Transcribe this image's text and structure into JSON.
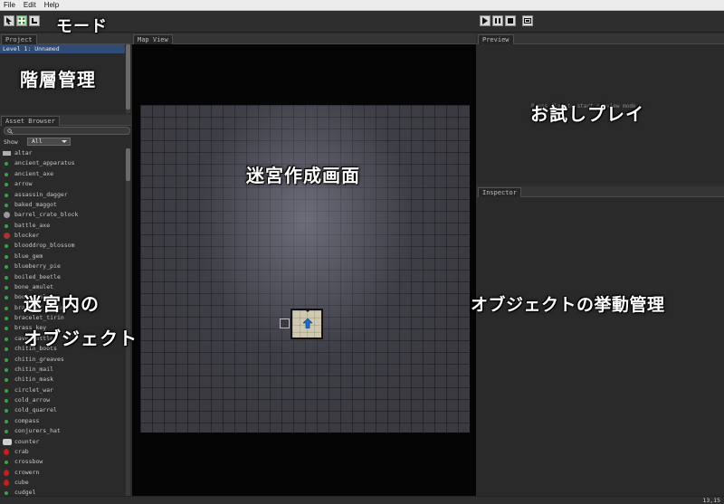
{
  "menu": {
    "items": [
      "File",
      "Edit",
      "Help"
    ]
  },
  "panels": {
    "project": {
      "tab": "Project",
      "selected_row": "Level 1: Unnamed"
    },
    "asset_browser": {
      "tab": "Asset Browser",
      "show_label": "Show",
      "show_value": "All",
      "items": [
        {
          "label": "altar",
          "icon": "flag-icon"
        },
        {
          "label": "ancient_apparatus",
          "icon": "item-dot-icon"
        },
        {
          "label": "ancient_axe",
          "icon": "item-dot-icon"
        },
        {
          "label": "arrow",
          "icon": "item-dot-icon"
        },
        {
          "label": "assassin_dagger",
          "icon": "item-dot-icon"
        },
        {
          "label": "baked_maggot",
          "icon": "item-dot-icon"
        },
        {
          "label": "barrel_crate_block",
          "icon": "barrel-icon"
        },
        {
          "label": "battle_axe",
          "icon": "item-dot-icon"
        },
        {
          "label": "blocker",
          "icon": "blocker-icon"
        },
        {
          "label": "blooddrop_blossom",
          "icon": "item-dot-icon"
        },
        {
          "label": "blue_gem",
          "icon": "item-dot-icon"
        },
        {
          "label": "blueberry_pie",
          "icon": "item-dot-icon"
        },
        {
          "label": "boiled_beetle",
          "icon": "item-dot-icon"
        },
        {
          "label": "bone_amulet",
          "icon": "item-dot-icon"
        },
        {
          "label": "boots_valor",
          "icon": "item-dot-icon"
        },
        {
          "label": "bracelet_tirin",
          "icon": "item-dot-icon"
        },
        {
          "label": "bracelet_tirin",
          "icon": "item-dot-icon"
        },
        {
          "label": "brass_key",
          "icon": "item-dot-icon"
        },
        {
          "label": "cave_nettle",
          "icon": "item-dot-icon"
        },
        {
          "label": "chitin_boots",
          "icon": "item-dot-icon"
        },
        {
          "label": "chitin_greaves",
          "icon": "item-dot-icon"
        },
        {
          "label": "chitin_mail",
          "icon": "item-dot-icon"
        },
        {
          "label": "chitin_mask",
          "icon": "item-dot-icon"
        },
        {
          "label": "circlet_war",
          "icon": "item-dot-icon"
        },
        {
          "label": "cold_arrow",
          "icon": "item-dot-icon"
        },
        {
          "label": "cold_quarrel",
          "icon": "item-dot-icon"
        },
        {
          "label": "compass",
          "icon": "item-dot-icon"
        },
        {
          "label": "conjurers_hat",
          "icon": "item-dot-icon"
        },
        {
          "label": "counter",
          "icon": "counter-icon"
        },
        {
          "label": "crab",
          "icon": "blood-drop-icon"
        },
        {
          "label": "crossbow",
          "icon": "item-dot-icon"
        },
        {
          "label": "crowern",
          "icon": "blood-drop-icon"
        },
        {
          "label": "cube",
          "icon": "blood-drop-icon"
        },
        {
          "label": "cudgel",
          "icon": "item-dot-icon"
        }
      ]
    },
    "map_view": {
      "tab": "Map View"
    },
    "preview": {
      "tab": "Preview",
      "hint": "Press Play to start preview mode"
    },
    "inspector": {
      "tab": "Inspector"
    }
  },
  "status": {
    "coords": "13,15"
  },
  "annotations": {
    "mode": "モード",
    "hierarchy": "階層管理",
    "trial_play": "お試しプレイ",
    "maze_editor": "迷宮作成画面",
    "maze_objects_line1": "迷宮内の",
    "maze_objects_line2": "オブジェクト",
    "object_behavior": "オブジェクトの挙動管理"
  },
  "colors": {
    "background": "#2d2d2d",
    "selection": "#2f4a75",
    "item_icon": "#3da04a",
    "monster_icon": "#c41e1e"
  }
}
